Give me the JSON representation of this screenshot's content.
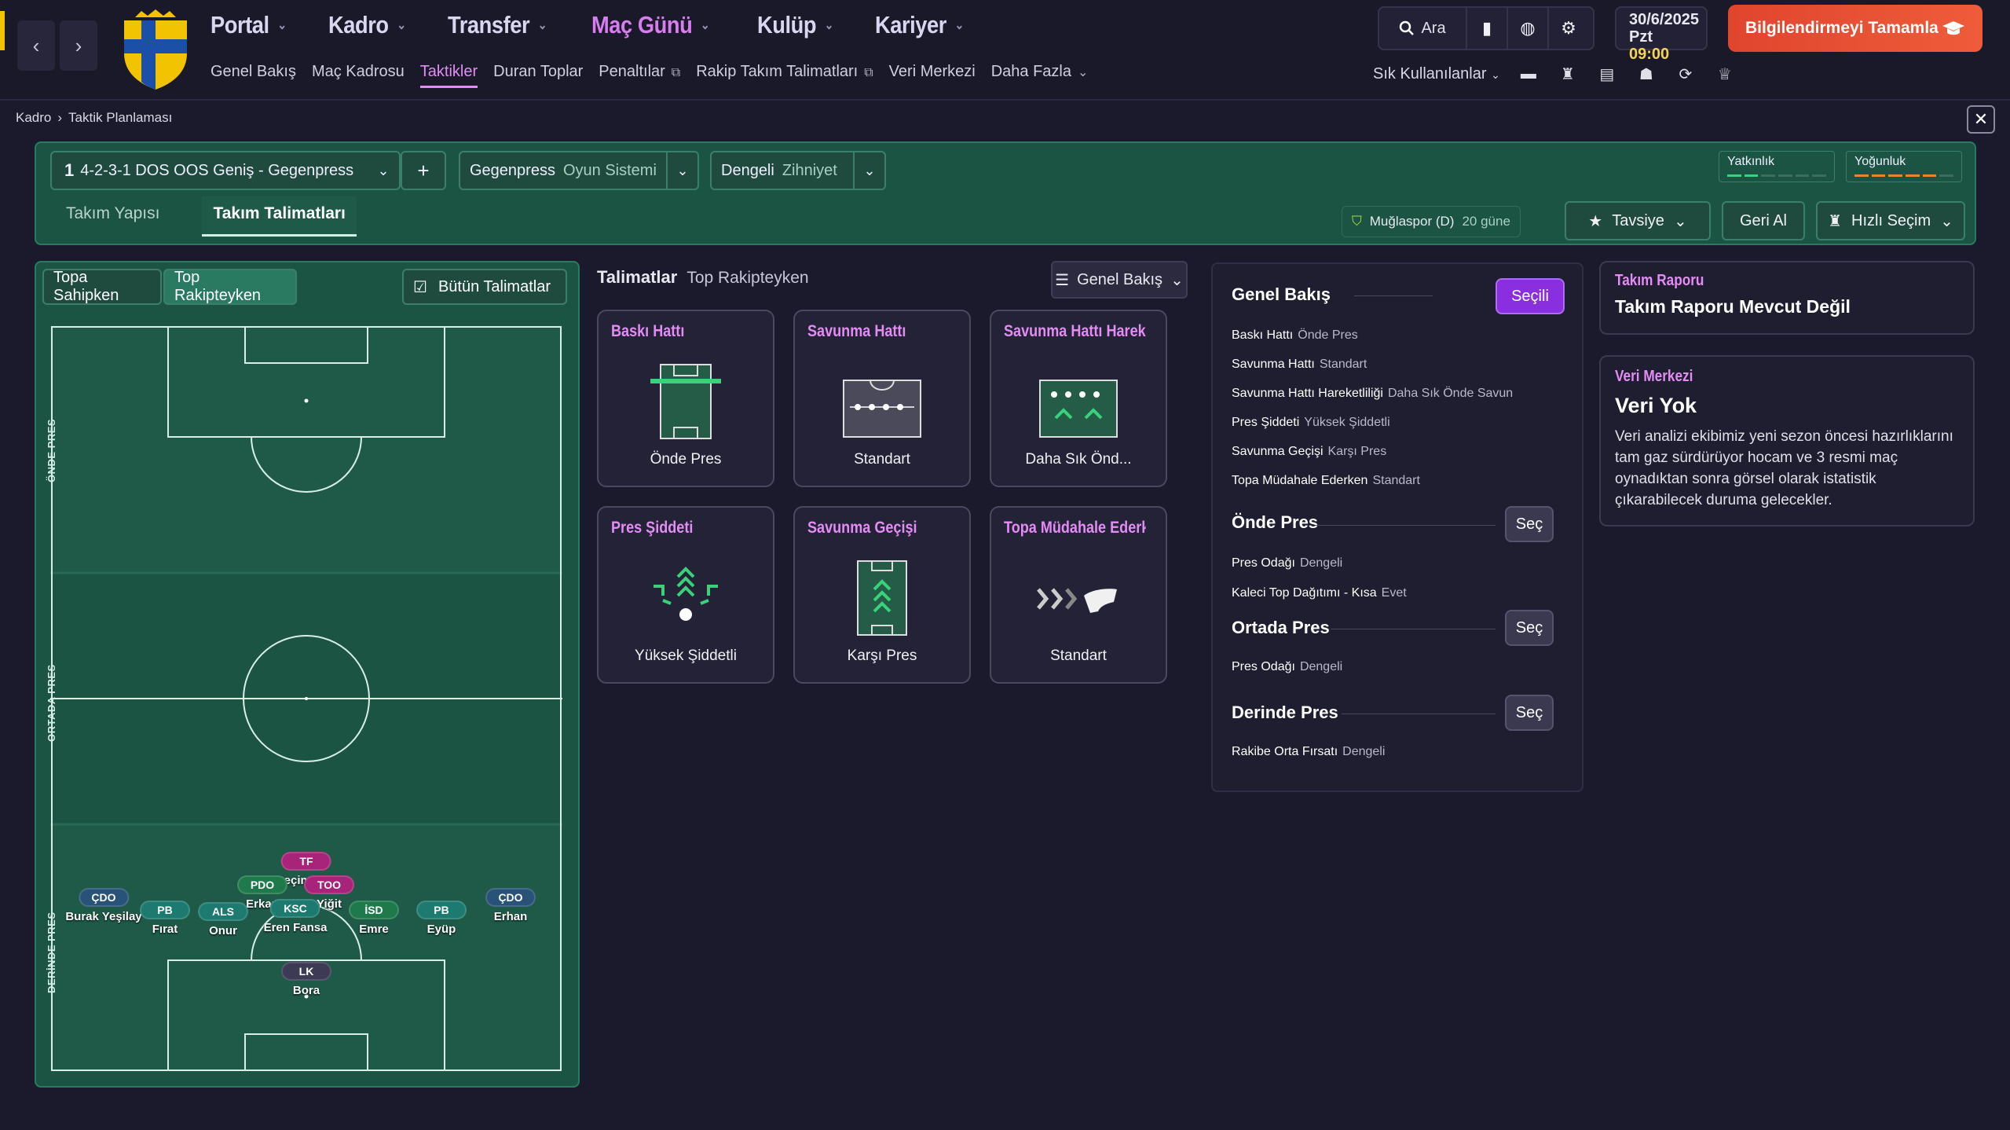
{
  "nav": {
    "main": [
      {
        "label": "Portal",
        "active": false
      },
      {
        "label": "Kadro",
        "active": false
      },
      {
        "label": "Transfer",
        "active": false
      },
      {
        "label": "Maç Günü",
        "active": true
      },
      {
        "label": "Kulüp",
        "active": false
      },
      {
        "label": "Kariyer",
        "active": false
      }
    ],
    "sub": [
      "Genel Bakış",
      "Maç Kadrosu",
      "Taktikler",
      "Duran Toplar",
      "Penaltılar",
      "Rakip Takım Talimatları",
      "Veri Merkezi",
      "Daha Fazla"
    ],
    "search_label": "Ara",
    "date": "30/6/2025",
    "day": "Pzt",
    "time": "09:00",
    "continue_label": "Bilgilendirmeyi Tamamla",
    "favorites_label": "Sık Kullanılanlar"
  },
  "breadcrumb": {
    "parent": "Kadro",
    "current": "Taktik Planlaması"
  },
  "tactic": {
    "number": "1",
    "formation": "4-2-3-1 DOS OOS Geniş - Gegenpress",
    "add_label": "+",
    "system_value": "Gegenpress",
    "system_label": "Oyun Sistemi",
    "mentality_value": "Dengeli",
    "mentality_label": "Zihniyet",
    "meter1": "Yatkınlık",
    "meter2": "Yoğunluk",
    "tabs": [
      "Takım Yapısı",
      "Takım Talimatları"
    ],
    "opponent": "Muğlaspor (D)",
    "days": "20 güne",
    "advice_label": "Tavsiye",
    "undo_label": "Geri Al",
    "quick_label": "Hızlı Seçim"
  },
  "pitch": {
    "seg_possession": "Topa Sahipken",
    "seg_defending": "Top Rakipteyken",
    "all_label": "Bütün Talimatlar",
    "zones": [
      "ÖNDE PRES",
      "ORTADA PRES",
      "DERİNDE PRES"
    ],
    "players": [
      {
        "pos": "TF",
        "name": "Seçim Koç",
        "color": "#a8247a"
      },
      {
        "pos": "PDO",
        "name": "Erkan",
        "color": "#1f7a4b"
      },
      {
        "pos": "TOO",
        "name": "Yiğit",
        "color": "#a8247a"
      },
      {
        "pos": "ÇDO",
        "name": "Burak Yeşilay",
        "color": "#285277"
      },
      {
        "pos": "ÇDO",
        "name": "Erhan",
        "color": "#285277"
      },
      {
        "pos": "PB",
        "name": "Fırat",
        "color": "#1d7a70"
      },
      {
        "pos": "ALS",
        "name": "Onur",
        "color": "#1d7a70"
      },
      {
        "pos": "KSC",
        "name": "Eren Fansa",
        "color": "#1d7a70"
      },
      {
        "pos": "İSD",
        "name": "Emre",
        "color": "#1f7a4b"
      },
      {
        "pos": "PB",
        "name": "Eyüp",
        "color": "#1d7a70"
      },
      {
        "pos": "LK",
        "name": "Bora",
        "color": "#3c3a55"
      }
    ]
  },
  "instructions": {
    "title": "Talimatlar",
    "subtitle": "Top Rakipteyken",
    "view_label": "Genel Bakış",
    "cards": [
      {
        "title": "Baskı Hattı",
        "value": "Önde Pres"
      },
      {
        "title": "Savunma Hattı",
        "value": "Standart"
      },
      {
        "title": "Savunma Hattı Hareketliliği",
        "value": "Daha Sık Önd..."
      },
      {
        "title": "Pres Şiddeti",
        "value": "Yüksek Şiddetli"
      },
      {
        "title": "Savunma Geçişi",
        "value": "Karşı Pres"
      },
      {
        "title": "Topa Müdahale Ederken",
        "value": "Standart"
      }
    ]
  },
  "overview": {
    "title": "Genel Bakış",
    "selected_label": "Seçili",
    "rows": [
      {
        "k": "Baskı Hattı",
        "v": "Önde Pres"
      },
      {
        "k": "Savunma Hattı",
        "v": "Standart"
      },
      {
        "k": "Savunma Hattı Hareketliliği",
        "v": "Daha Sık Önde Savun"
      },
      {
        "k": "Pres Şiddeti",
        "v": "Yüksek Şiddetli"
      },
      {
        "k": "Savunma Geçişi",
        "v": "Karşı Pres"
      },
      {
        "k": "Topa Müdahale Ederken",
        "v": "Standart"
      }
    ],
    "select_label": "Seç",
    "s1": {
      "title": "Önde Pres",
      "rows": [
        {
          "k": "Pres Odağı",
          "v": "Dengeli"
        },
        {
          "k": "Kaleci Top Dağıtımı - Kısa",
          "v": "Evet"
        }
      ]
    },
    "s2": {
      "title": "Ortada Pres",
      "rows": [
        {
          "k": "Pres Odağı",
          "v": "Dengeli"
        }
      ]
    },
    "s3": {
      "title": "Derinde Pres",
      "rows": [
        {
          "k": "Rakibe Orta Fırsatı",
          "v": "Dengeli"
        }
      ]
    }
  },
  "report": {
    "tag": "Takım Raporu",
    "title": "Takım Raporu Mevcut Değil"
  },
  "datahub": {
    "tag": "Veri Merkezi",
    "title": "Veri Yok",
    "body": "Veri analizi ekibimiz yeni sezon öncesi hazırlıklarını tam gaz sürdürüyor hocam ve 3 resmi maç oynadıktan sonra görsel olarak istatistik çıkarabilecek duruma gelecekler."
  },
  "colors": {
    "accent": "#e48cf6",
    "panel_green": "#1c5444",
    "cta": "#e0452e",
    "select_purple": "#8a2fe0"
  }
}
